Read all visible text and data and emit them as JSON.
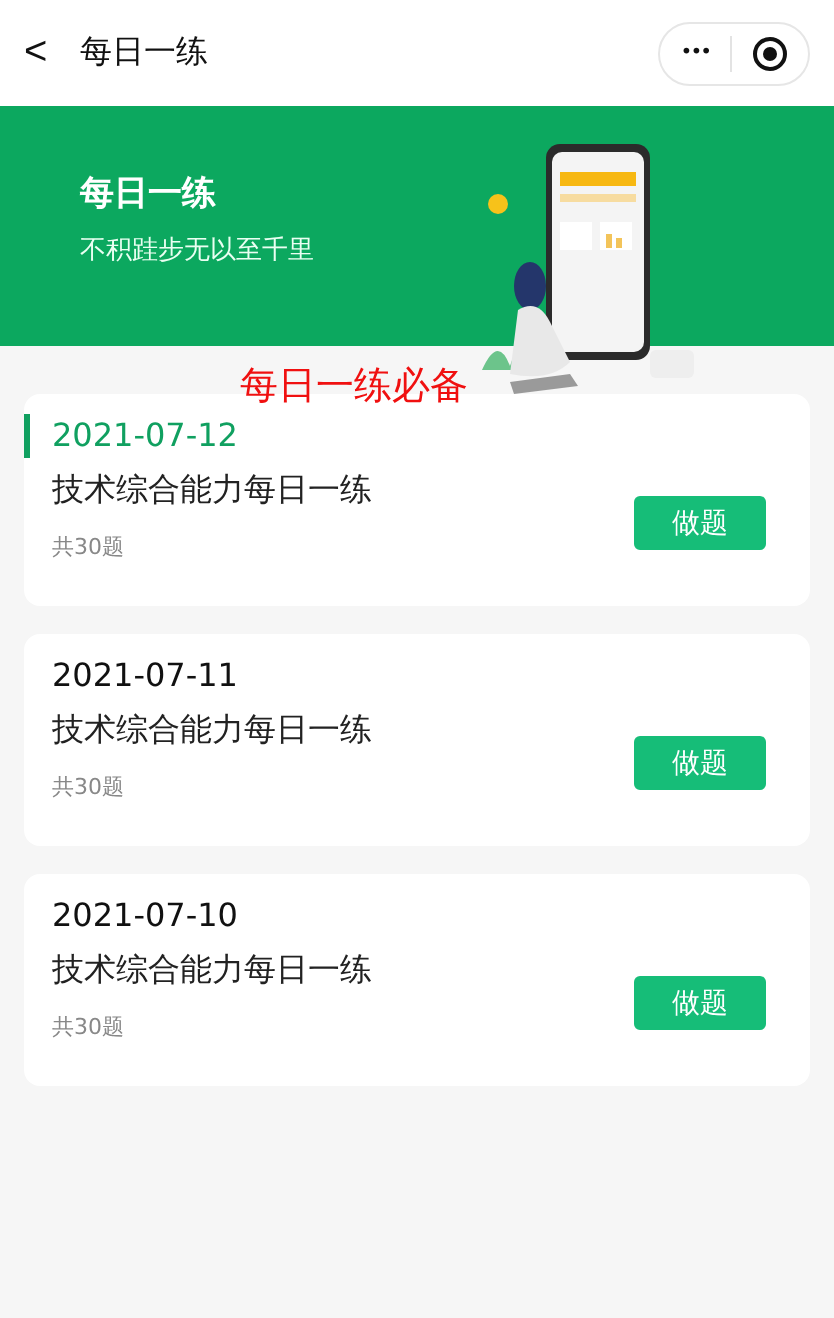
{
  "nav": {
    "back": "<",
    "title": "每日一练",
    "more": "•••"
  },
  "banner": {
    "title": "每日一练",
    "subtitle": "不积跬步无以至千里"
  },
  "annotation": "每日一练必备",
  "cards": [
    {
      "date": "2021-07-12",
      "title": "技术综合能力每日一练",
      "count": "共30题",
      "button": "做题",
      "selected": true
    },
    {
      "date": "2021-07-11",
      "title": "技术综合能力每日一练",
      "count": "共30题",
      "button": "做题",
      "selected": false
    },
    {
      "date": "2021-07-10",
      "title": "技术综合能力每日一练",
      "count": "共30题",
      "button": "做题",
      "selected": false
    }
  ]
}
